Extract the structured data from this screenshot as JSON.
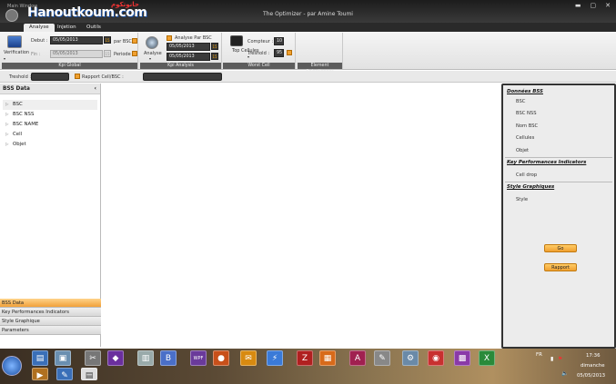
{
  "app": {
    "title": "The Optimizer - par Amine Toumi",
    "window_label": "Main Window",
    "logo_text": "Hanoutkoum.com",
    "logo_arabic": "حانوتكوم"
  },
  "tabs": [
    "Analyse",
    "Injetion",
    "Outils"
  ],
  "ribbon": {
    "groups": [
      {
        "label": "Kpi Global"
      },
      {
        "label": "Kpi Analysis"
      },
      {
        "label": "Worst Cell"
      },
      {
        "label": "Element Selectionner"
      }
    ],
    "verification_label": "Verification",
    "debut_label": "Debut :",
    "debut_value": "05/05/2013",
    "fin_label": "Fin :",
    "fin_value": "05/05/2013",
    "par_bsc_label": "par BSC",
    "periode_label": "Periode",
    "analyse_label": "Analyse",
    "analyse_par_bsc_label": "Analyse Par BSC",
    "date1": "05/05/2013",
    "date2": "05/05/2013",
    "top_cellules_label": "Top Cellules",
    "compteur_label": "Compteur :",
    "compteur_value": "10",
    "treshold_label": "Treshold :",
    "treshold_value": "95"
  },
  "filterbar": {
    "treshold_label": "Treshold :",
    "rapport_label": "Rapport Cell/BSC :"
  },
  "left_panel": {
    "title": "BSS Data",
    "tree": [
      "BSC",
      "BSC NSS",
      "BSC NAME",
      "Cell",
      "Objet"
    ],
    "accordion": [
      "BSS Data",
      "Key Performances Indicators",
      "Style Graphique",
      "Parameters"
    ]
  },
  "right_panel": {
    "sections": [
      {
        "header": "Données BSS",
        "items": [
          "BSC",
          "BSC NSS",
          "Nom BSC",
          "Cellules",
          "Objet"
        ]
      },
      {
        "header": "Key Performances Indicators",
        "items": [
          "Cell drop"
        ]
      },
      {
        "header": "Style Graphiques",
        "items": [
          "Style"
        ]
      }
    ],
    "go_button": "Go",
    "rapport_button": "Rapport"
  },
  "taskbar": {
    "lang": "FR",
    "time": "17:36",
    "day": "dimanche",
    "date": "05/05/2013",
    "icons": [
      "folder-icon",
      "windows-explorer-icon",
      "tools-icon",
      "visual-studio-icon",
      "document-icon",
      "b-app-icon",
      "wpf-icon",
      "firefox-icon",
      "outlook-icon",
      "power-icon",
      "filezilla-icon",
      "office-icon",
      "access-icon",
      "notepad-icon",
      "settings-icon",
      "chrome-icon",
      "winrar-icon",
      "excel-icon"
    ]
  },
  "colors": {
    "accent": "#f0a030",
    "titlebar": "#1c1c1c",
    "ribbon": "#ececec"
  }
}
